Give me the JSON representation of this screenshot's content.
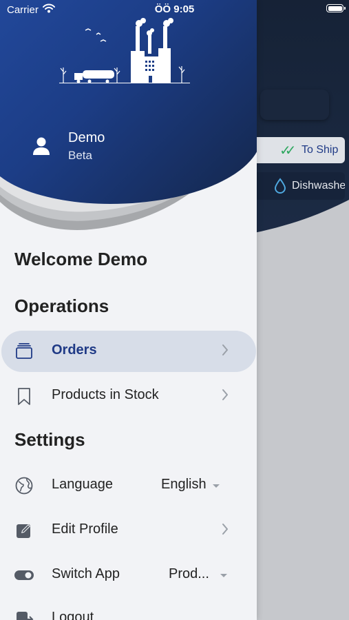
{
  "status_bar": {
    "carrier": "Carrier",
    "time": "ÖÖ 9:05"
  },
  "background_app": {
    "chip_to_ship": "To Ship",
    "chip_dishwasher": "Dishwashe"
  },
  "drawer": {
    "user": {
      "name": "Demo",
      "role": "Beta"
    },
    "welcome": "Welcome Demo",
    "sections": {
      "operations": "Operations",
      "settings": "Settings"
    },
    "items": {
      "orders": "Orders",
      "products": "Products in Stock",
      "language": "Language",
      "language_value": "English",
      "edit_profile": "Edit Profile",
      "switch_app": "Switch App",
      "switch_app_value": "Prod...",
      "logout": "Logout"
    }
  },
  "colors": {
    "header_blue": "#1c3d86",
    "accent": "#1f3a86",
    "selected_bg": "#d7dde8",
    "drawer_bg": "#f2f3f6"
  }
}
